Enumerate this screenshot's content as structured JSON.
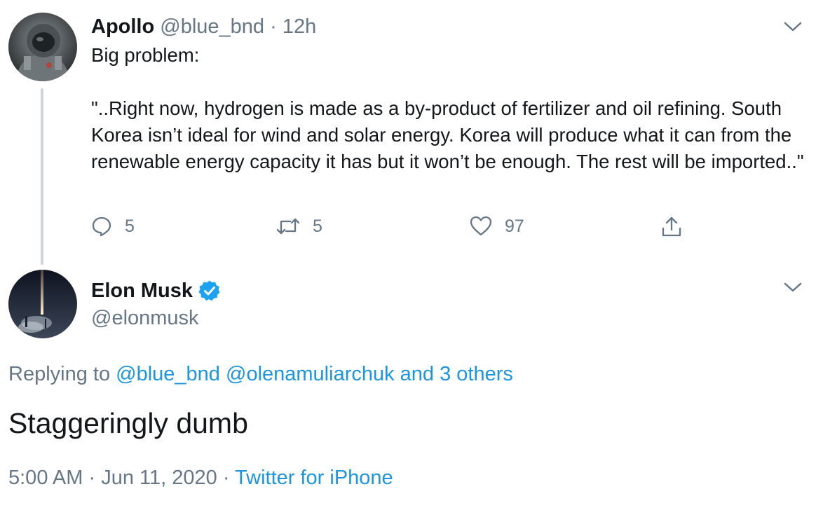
{
  "parent_tweet": {
    "name": "Apollo",
    "handle": "@blue_bnd",
    "separator": "·",
    "time": "12h",
    "body_line1": "Big problem:",
    "body_quote": "\"..Right now, hydrogen is made as a by-product of fertilizer and oil refining. South Korea isn’t ideal for wind and solar energy. Korea will produce what it can from the renewable energy capacity it has but it won’t be enough. The rest will be imported..\"",
    "actions": {
      "replies": "5",
      "retweets": "5",
      "likes": "97"
    }
  },
  "main_tweet": {
    "name": "Elon Musk",
    "handle": "@elonmusk",
    "replying_prefix": "Replying to",
    "replying_to_1": "@blue_bnd",
    "replying_to_2": "@olenamuliarchuk",
    "replying_others": "and 3 others",
    "text": "Staggeringly dumb",
    "time": "5:00 AM",
    "separator": "·",
    "date": "Jun 11, 2020",
    "source": "Twitter for iPhone"
  },
  "colors": {
    "link": "#1b95e0",
    "muted": "#657786",
    "text": "#14171a",
    "verified": "#1da1f2",
    "thread_line": "#ccd6dd"
  },
  "icons": {
    "reply": "reply-icon",
    "retweet": "retweet-icon",
    "like": "heart-icon",
    "share": "share-icon",
    "verified": "verified-badge-icon",
    "caret": "chevron-down-icon"
  }
}
